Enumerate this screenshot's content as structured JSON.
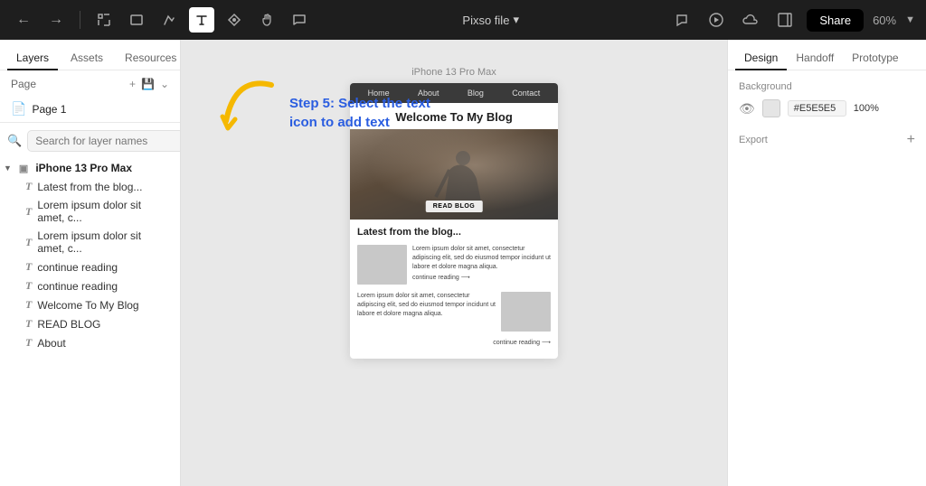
{
  "toolbar": {
    "file_name": "Pixso file",
    "file_name_arrow": "▾",
    "share_label": "Share",
    "zoom_level": "60%",
    "icons": [
      "back",
      "forward",
      "frame",
      "rectangle",
      "vector",
      "text",
      "pen",
      "hand",
      "comment"
    ]
  },
  "left_sidebar": {
    "tabs": [
      "Layers",
      "Assets",
      "Resources"
    ],
    "active_tab": "Layers",
    "page_label": "Page",
    "page_name": "Page 1",
    "search_placeholder": "Search for layer names",
    "layers": [
      {
        "type": "parent",
        "label": "iPhone 13 Pro Max",
        "indent": 0
      },
      {
        "type": "text",
        "label": "Latest from the blog...",
        "indent": 1
      },
      {
        "type": "text",
        "label": "Lorem ipsum dolor sit amet, c...",
        "indent": 1
      },
      {
        "type": "text",
        "label": "Lorem ipsum dolor sit amet, c...",
        "indent": 1
      },
      {
        "type": "text",
        "label": "continue reading",
        "indent": 1
      },
      {
        "type": "text",
        "label": "continue reading",
        "indent": 1
      },
      {
        "type": "text",
        "label": "Welcome To My Blog",
        "indent": 1
      },
      {
        "type": "text",
        "label": "READ BLOG",
        "indent": 1
      },
      {
        "type": "text",
        "label": "About",
        "indent": 1
      }
    ]
  },
  "canvas": {
    "phone_label": "iPhone 13 Pro Max",
    "annotation_text": "Step 5: Select the text icon to add text",
    "nav_items": [
      "Home",
      "About",
      "Blog",
      "Contact"
    ],
    "hero_title": "Welcome To My Blog",
    "read_blog_btn": "READ BLOG",
    "blog_section_title": "Latest from the blog...",
    "blog_post1_text": "Lorem ipsum dolor sit amet, consectetur adipiscing elit, sed do eiusmod tempor incidunt ut labore et dolore magna aliqua.",
    "blog_post1_continue": "continue reading ⟶",
    "blog_post2_text": "Lorem ipsum dolor sit amet, consectetur adipiscing elit, sed do eiusmod tempor incidunt ut labore et dolore magna aliqua.",
    "blog_post2_continue": "continue reading ⟶"
  },
  "right_panel": {
    "tabs": [
      "Design",
      "Handoff",
      "Prototype"
    ],
    "active_tab": "Design",
    "background_label": "Background",
    "bg_color_hex": "#E5E5E5",
    "bg_opacity": "100",
    "bg_opacity_unit": "%",
    "export_label": "Export"
  }
}
